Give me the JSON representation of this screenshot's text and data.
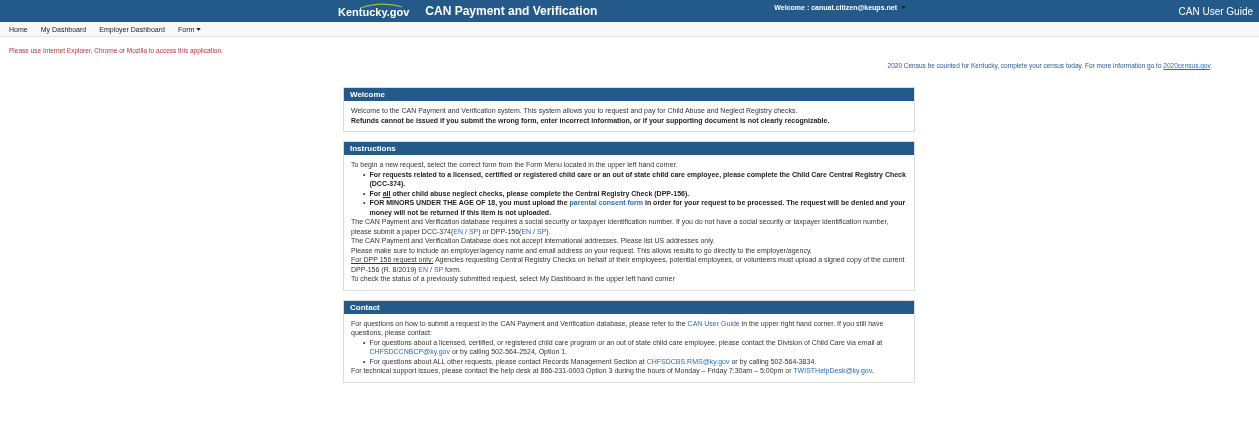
{
  "header": {
    "logo": "Kentucky.gov",
    "title": "CAN Payment and Verification",
    "welcome": "Welcome : canuat.citizen@keups.net",
    "guide": "CAN User Guide"
  },
  "nav": [
    {
      "label": "Home",
      "dropdown": false
    },
    {
      "label": "My Dashboard",
      "dropdown": false
    },
    {
      "label": "Employer Dashboard",
      "dropdown": false
    },
    {
      "label": "Form",
      "dropdown": true
    }
  ],
  "browser_notice": "Please use Internet Explorer, Chrome or Mozilla to access this application.",
  "census": [
    {
      "kind": "text",
      "text": "2020 Census be counted for Kentucky, complete your census today. For more information go to "
    },
    {
      "kind": "underline_link",
      "text": "2020census.gov"
    },
    {
      "kind": "text",
      "text": "."
    }
  ],
  "panels": [
    {
      "title": "Welcome",
      "blocks": [
        {
          "kind": "para",
          "bold": false,
          "segments": [
            {
              "kind": "text",
              "text": "Welcome to the CAN Payment and Verification system. This system allows you to request and pay for Child Abuse and Neglect Registry checks."
            }
          ]
        },
        {
          "kind": "para",
          "bold": true,
          "segments": [
            {
              "kind": "text",
              "text": "Refunds cannot be issued if you submit the wrong form, enter incorrect information, or if your supporting document is not clearly recognizable."
            }
          ]
        }
      ]
    },
    {
      "title": "Instructions",
      "blocks": [
        {
          "kind": "para",
          "bold": false,
          "segments": [
            {
              "kind": "text",
              "text": "To begin a new request, select the correct form from the Form Menu located in the upper left hand corner."
            }
          ]
        },
        {
          "kind": "list",
          "items": [
            {
              "marker": "•",
              "bold": true,
              "segments": [
                {
                  "kind": "text",
                  "text": "For requests related to a licensed, certified or registered child care or an out of state child care employee, please complete the Child Care Central Registry Check (DCC-374)."
                }
              ]
            },
            {
              "marker": "•",
              "bold": true,
              "segments": [
                {
                  "kind": "text",
                  "text": "For "
                },
                {
                  "kind": "underline",
                  "text": "all"
                },
                {
                  "kind": "text",
                  "text": " other child abuse neglect checks, please complete the Central Registry Check (DPP-156)."
                }
              ]
            },
            {
              "marker": "•",
              "bold": true,
              "segments": [
                {
                  "kind": "text",
                  "text": "FOR MINORS UNDER THE AGE OF 18, you must upload the "
                },
                {
                  "kind": "link",
                  "text": "parental consent form"
                },
                {
                  "kind": "text",
                  "text": " in order for your request to be processed. The request will be denied and your money will not be returned if this item is not uploaded."
                }
              ]
            }
          ]
        },
        {
          "kind": "para",
          "bold": false,
          "segments": [
            {
              "kind": "text",
              "text": "The CAN Payment and Verification database requires a social security or taxpayer identification number. If you do not have a social security or taxpayer identification number, please submit a paper DCC-374("
            },
            {
              "kind": "link",
              "text": "EN"
            },
            {
              "kind": "text",
              "text": " / "
            },
            {
              "kind": "link",
              "text": "SP"
            },
            {
              "kind": "text",
              "text": ") or DPP-156("
            },
            {
              "kind": "link",
              "text": "EN"
            },
            {
              "kind": "text",
              "text": " / "
            },
            {
              "kind": "link",
              "text": "SP"
            },
            {
              "kind": "text",
              "text": ")."
            }
          ]
        },
        {
          "kind": "para",
          "bold": false,
          "segments": [
            {
              "kind": "text",
              "text": "The CAN Payment and Verification Database does not accept international addresses. Please list US addresses only."
            }
          ]
        },
        {
          "kind": "para",
          "bold": false,
          "segments": [
            {
              "kind": "text",
              "text": "Please make sure to include an employer/agency name and email address on your request. This allows results to go directly to the employer/agency."
            }
          ]
        },
        {
          "kind": "para",
          "bold": false,
          "segments": [
            {
              "kind": "underline",
              "text": "For DPP 156 request only:"
            },
            {
              "kind": "text",
              "text": " Agencies requesting Central Registry Checks on behalf of their employees, potential employees, or volunteers must upload a signed copy of the current DPP-156 (R. 8/2019) "
            },
            {
              "kind": "link",
              "text": "EN"
            },
            {
              "kind": "text",
              "text": " / "
            },
            {
              "kind": "link",
              "text": "SP"
            },
            {
              "kind": "text",
              "text": " form."
            }
          ]
        },
        {
          "kind": "para",
          "bold": false,
          "segments": [
            {
              "kind": "text",
              "text": "To check the status of a previously submitted request, select My Dashboard in the upper left hand corner"
            }
          ]
        }
      ]
    },
    {
      "title": "Contact",
      "blocks": [
        {
          "kind": "para",
          "bold": false,
          "segments": [
            {
              "kind": "text",
              "text": "For questions on how to submit a request in the CAN Payment and Verification database, please refer to the "
            },
            {
              "kind": "link",
              "text": "CAN User Guide"
            },
            {
              "kind": "text",
              "text": " in the upper right hand corner. If you still have questions, please contact:"
            }
          ]
        },
        {
          "kind": "list",
          "items": [
            {
              "marker": "•",
              "bold": false,
              "segments": [
                {
                  "kind": "text",
                  "text": "For questions about a licensed, certified, or registered child care program or an out of state child care employee, please contact the Division of Child Care via email at "
                },
                {
                  "kind": "link",
                  "text": "CHFSDCCNBCP@ky.gov"
                },
                {
                  "kind": "text",
                  "text": " or by calling 502-564-2524, Option 1."
                }
              ]
            },
            {
              "marker": "•",
              "bold": false,
              "segments": [
                {
                  "kind": "text",
                  "text": "For questions about ALL other requests, please contact Records Management Section at "
                },
                {
                  "kind": "link",
                  "text": "CHFSDCBS.RMS@ky.gov"
                },
                {
                  "kind": "text",
                  "text": " or by calling 502-564-3834."
                }
              ]
            }
          ]
        },
        {
          "kind": "para",
          "bold": false,
          "segments": [
            {
              "kind": "text",
              "text": "For technical support issues, please contact the help desk at 866-231-0003 Option 3 during the hours of Monday – Friday 7:30am – 5:00pm or "
            },
            {
              "kind": "link",
              "text": "TWISTHelpDesk@ky.gov"
            },
            {
              "kind": "text",
              "text": "."
            }
          ]
        }
      ]
    }
  ]
}
